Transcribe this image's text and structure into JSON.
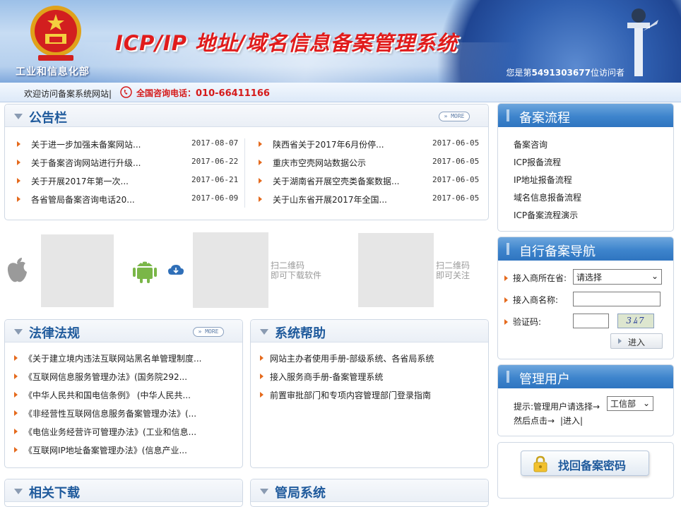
{
  "header": {
    "ministry": "工业和信息化部",
    "title": "ICP/IP 地址/域名信息备案管理系统",
    "visitors_prefix": "您是第",
    "visitors_count": "5491303677",
    "visitors_suffix": "位访问者"
  },
  "infobar": {
    "welcome": "欢迎访问备案系统网站",
    "hotline_label": "全国咨询电话：",
    "hotline_number": "010-66411166"
  },
  "notice": {
    "title": "公告栏",
    "more": "MORE",
    "left": [
      {
        "title": "关于进一步加强未备案网站...",
        "date": "2017-08-07"
      },
      {
        "title": "关于备案咨询网站进行升级...",
        "date": "2017-06-22"
      },
      {
        "title": "关于开展2017年第一次...",
        "date": "2017-06-21"
      },
      {
        "title": "各省管局备案咨询电话20...",
        "date": "2017-06-09"
      }
    ],
    "right": [
      {
        "title": "陕西省关于2017年6月份停...",
        "date": "2017-06-05"
      },
      {
        "title": "重庆市空壳网站数据公示",
        "date": "2017-06-05"
      },
      {
        "title": "关于湖南省开展空壳类备案数据...",
        "date": "2017-06-05"
      },
      {
        "title": "关于山东省开展2017年全国...",
        "date": "2017-06-05"
      }
    ]
  },
  "download": {
    "qr1_caption_line1": "扫二维码",
    "qr1_caption_line2": "即可下载软件",
    "qr2_caption_line1": "扫二维码",
    "qr2_caption_line2": "即可关注"
  },
  "law": {
    "title": "法律法规",
    "more": "MORE",
    "items": [
      "《关于建立境内违法互联网站黑名单管理制度...",
      "《互联网信息服务管理办法》(国务院292...",
      "《中华人民共和国电信条例》 (中华人民共...",
      "《非经营性互联网信息服务备案管理办法》(...",
      "《电信业务经营许可管理办法》(工业和信息...",
      "《互联网IP地址备案管理办法》(信息产业..."
    ]
  },
  "help": {
    "title": "系统帮助",
    "items": [
      "网站主办者使用手册-部级系统、各省局系统",
      "接入服务商手册-备案管理系统",
      "前置审批部门和专项内容管理部门登录指南"
    ]
  },
  "bottom_partial": {
    "left_title": "相关下载",
    "right_title": "管局系统"
  },
  "flow": {
    "title": "备案流程",
    "items": [
      "备案咨询",
      "ICP报备流程",
      "IP地址报备流程",
      "域名信息报备流程",
      "ICP备案流程演示"
    ]
  },
  "self_nav": {
    "title": "自行备案导航",
    "province_label": "接入商所在省:",
    "province_value": "请选择",
    "name_label": "接入商名称:",
    "captcha_label": "验证码:",
    "captcha_text": "3ﾑ7",
    "go_label": "进入"
  },
  "admin": {
    "title": "管理用户",
    "hint": "提示:管理用户请选择→",
    "select_value": "工信部",
    "then": "然后点击→",
    "enter": "|进入|"
  },
  "recover": {
    "label": "找回备案密码"
  },
  "colors": {
    "brand_blue": "#1f5a9c",
    "title_red": "#e11b1b",
    "bullet_orange": "#e56a1d",
    "header_blue": "#3d84cc"
  }
}
